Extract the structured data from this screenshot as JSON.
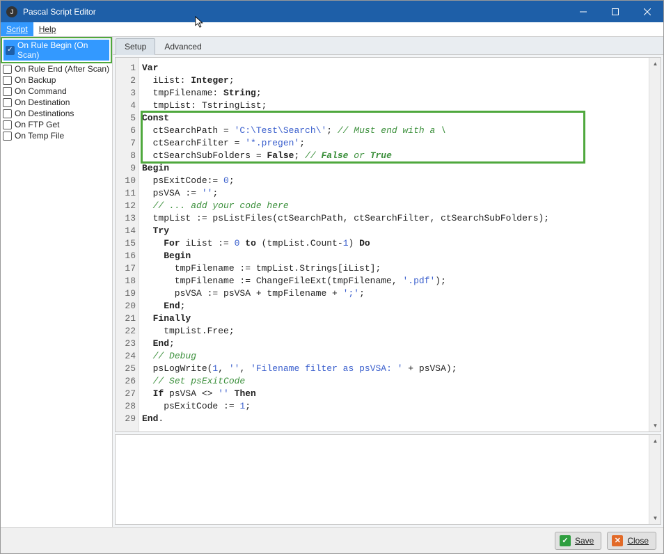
{
  "window": {
    "title": "Pascal Script Editor"
  },
  "menu": {
    "script": "Script",
    "help": "Help"
  },
  "sidebar": {
    "items": [
      {
        "label": "On Rule Begin (On Scan)",
        "checked": true,
        "selected": true
      },
      {
        "label": "On Rule End (After Scan)",
        "checked": false,
        "selected": false
      },
      {
        "label": "On Backup",
        "checked": false,
        "selected": false
      },
      {
        "label": "On Command",
        "checked": false,
        "selected": false
      },
      {
        "label": "On Destination",
        "checked": false,
        "selected": false
      },
      {
        "label": "On Destinations",
        "checked": false,
        "selected": false
      },
      {
        "label": "On FTP Get",
        "checked": false,
        "selected": false
      },
      {
        "label": "On Temp File",
        "checked": false,
        "selected": false
      }
    ]
  },
  "tabs": {
    "setup": "Setup",
    "advanced": "Advanced"
  },
  "code": {
    "lines": [
      "Var",
      "  iList: Integer;",
      "  tmpFilename: String;",
      "  tmpList: TstringList;",
      "Const",
      "  ctSearchPath = 'C:\\Test\\Search\\'; // Must end with a \\",
      "  ctSearchFilter = '*.pregen';",
      "  ctSearchSubFolders = False; // False or True",
      "Begin",
      "  psExitCode:= 0;",
      "  psVSA := '';",
      "  // ... add your code here",
      "  tmpList := psListFiles(ctSearchPath, ctSearchFilter, ctSearchSubFolders);",
      "  Try",
      "    For iList := 0 to (tmpList.Count-1) Do",
      "    Begin",
      "      tmpFilename := tmpList.Strings[iList];",
      "      tmpFilename := ChangeFileExt(tmpFilename, '.pdf');",
      "      psVSA := psVSA + tmpFilename + ';';",
      "    End;",
      "  Finally",
      "    tmpList.Free;",
      "  End;",
      "  // Debug",
      "  psLogWrite(1, '', 'Filename filter as psVSA: ' + psVSA);",
      "  // Set psExitCode",
      "  If psVSA <> '' Then",
      "    psExitCode := 1;",
      "End."
    ]
  },
  "footer": {
    "save": "Save",
    "close": "Close"
  }
}
